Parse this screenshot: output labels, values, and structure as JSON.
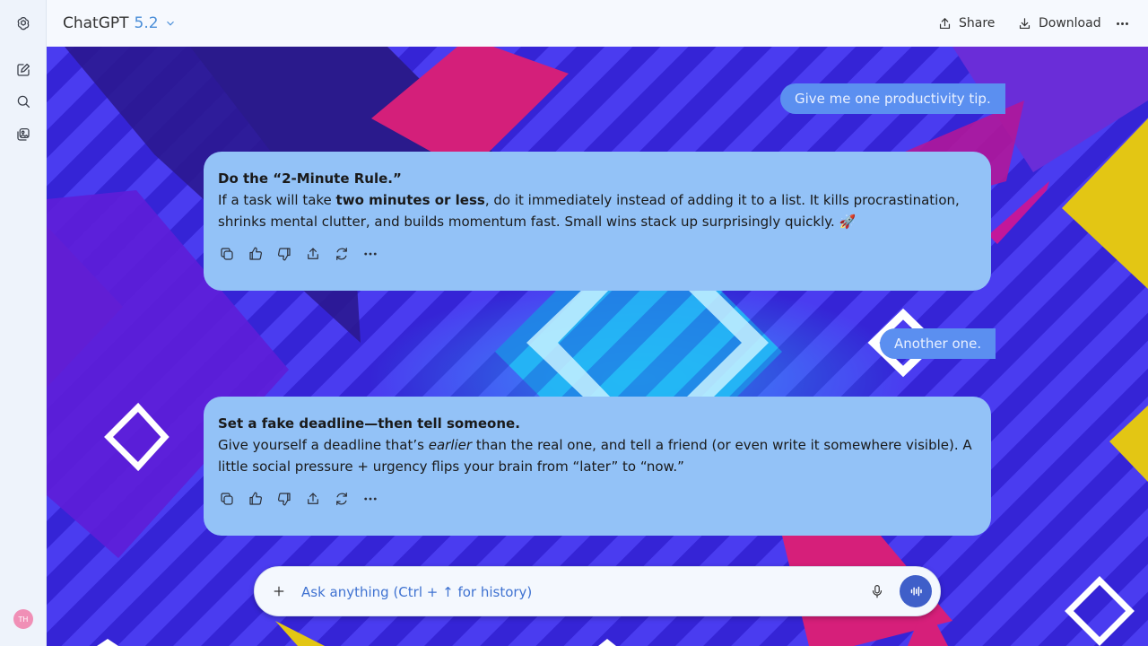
{
  "app": {
    "model_name": "ChatGPT",
    "model_version": "5.2"
  },
  "sidebar": {
    "items": [
      {
        "icon": "new-chat-icon"
      },
      {
        "icon": "search-icon"
      },
      {
        "icon": "library-icon"
      }
    ],
    "avatar_initials": "TH"
  },
  "header": {
    "share_label": "Share",
    "download_label": "Download"
  },
  "conversation": {
    "user_1": "Give me one productivity tip.",
    "assistant_1": {
      "title": "Do the “2-Minute Rule.”",
      "p1": "If a task will take ",
      "bold": "two minutes or less",
      "p2": ", do it immediately instead of adding it to a list. It kills procrastination, shrinks mental clutter, and builds momentum fast. Small wins stack up surprisingly quickly. 🚀"
    },
    "user_2": "Another one.",
    "assistant_2": {
      "title": "Set a fake deadline—then tell someone.",
      "p1": "Give yourself a deadline that’s ",
      "italic": "earlier",
      "p2": " than the real one, and tell a friend (or even write it somewhere visible). A little social pressure + urgency flips your brain from “later” to “now.”"
    },
    "message_actions": [
      "copy-icon",
      "thumbs-up-icon",
      "thumbs-down-icon",
      "share-icon",
      "regenerate-icon",
      "more-icon"
    ]
  },
  "composer": {
    "placeholder": "Ask anything (Ctrl + ↑ for history)"
  },
  "colors": {
    "accent": "#4a8ed8",
    "user_bubble": "#5b8ff0",
    "assistant_card": "#93c2f7",
    "voice_button": "#3f5fc9"
  }
}
